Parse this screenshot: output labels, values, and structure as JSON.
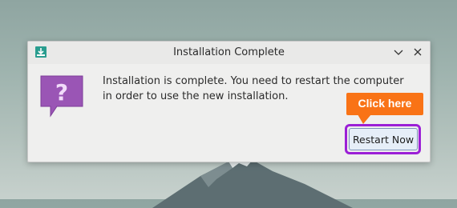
{
  "dialog": {
    "title": "Installation Complete",
    "message": "Installation is complete. You need to restart the computer in order to use the new installation.",
    "restart_label": "Restart Now"
  },
  "annotation": {
    "callout_label": "Click here",
    "callout_color": "#f97316",
    "highlight_color": "#9b1fd6"
  },
  "icons": {
    "app": "installer-icon",
    "minimize": "chevron-down-icon",
    "close": "close-icon",
    "question": "question-bubble-icon"
  }
}
